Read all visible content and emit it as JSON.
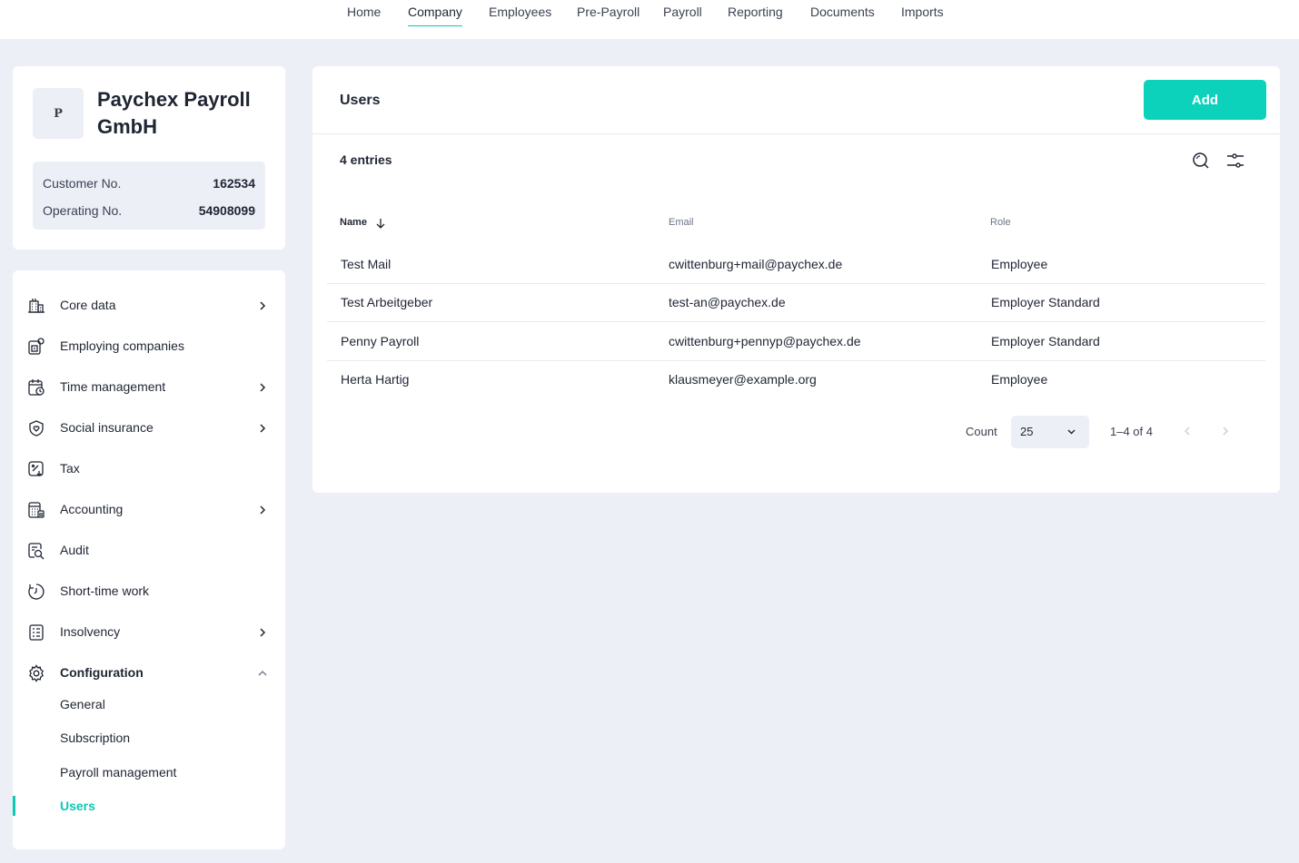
{
  "topnav": {
    "tabs": [
      {
        "label": "Home"
      },
      {
        "label": "Company",
        "active": true
      },
      {
        "label": "Employees"
      },
      {
        "label": "Pre-Payroll"
      },
      {
        "label": "Payroll"
      },
      {
        "label": "Reporting"
      },
      {
        "label": "Documents"
      },
      {
        "label": "Imports"
      }
    ]
  },
  "company": {
    "logo_letter": "P",
    "name": "Paychex Payroll GmbH",
    "customer_no_label": "Customer No.",
    "customer_no": "162534",
    "operating_no_label": "Operating No.",
    "operating_no": "54908099"
  },
  "sidebar": {
    "items": [
      {
        "label": "Core data",
        "icon": "building-icon",
        "chevron": "right"
      },
      {
        "label": "Employing companies",
        "icon": "companies-icon"
      },
      {
        "label": "Time management",
        "icon": "calendar-clock-icon",
        "chevron": "right"
      },
      {
        "label": "Social insurance",
        "icon": "shield-heart-icon",
        "chevron": "right"
      },
      {
        "label": "Tax",
        "icon": "tax-percent-icon"
      },
      {
        "label": "Accounting",
        "icon": "calculator-icon",
        "chevron": "right"
      },
      {
        "label": "Audit",
        "icon": "audit-search-icon"
      },
      {
        "label": "Short-time work",
        "icon": "clock-icon"
      },
      {
        "label": "Insolvency",
        "icon": "document-list-icon",
        "chevron": "right"
      },
      {
        "label": "Configuration",
        "icon": "gear-icon",
        "chevron": "up",
        "expanded": true
      }
    ],
    "subitems": [
      {
        "label": "General"
      },
      {
        "label": "Subscription"
      },
      {
        "label": "Payroll management"
      },
      {
        "label": "Users",
        "active": true
      }
    ]
  },
  "main": {
    "title": "Users",
    "add_label": "Add",
    "entries_label": "4 entries",
    "columns": {
      "name": "Name",
      "email": "Email",
      "role": "Role"
    },
    "rows": [
      {
        "name": "Test Mail",
        "email": "cwittenburg+mail@paychex.de",
        "role": "Employee"
      },
      {
        "name": "Test Arbeitgeber",
        "email": "test-an@paychex.de",
        "role": "Employer Standard"
      },
      {
        "name": "Penny Payroll",
        "email": "cwittenburg+pennyp@paychex.de",
        "role": "Employer Standard"
      },
      {
        "name": "Herta Hartig",
        "email": "klausmeyer@example.org",
        "role": "Employee"
      }
    ],
    "pagination": {
      "count_label": "Count",
      "count_value": "25",
      "range": "1–4 of 4"
    }
  },
  "colors": {
    "accent": "#0cd2bc",
    "background": "#eceff6",
    "text": "#1f2533"
  }
}
